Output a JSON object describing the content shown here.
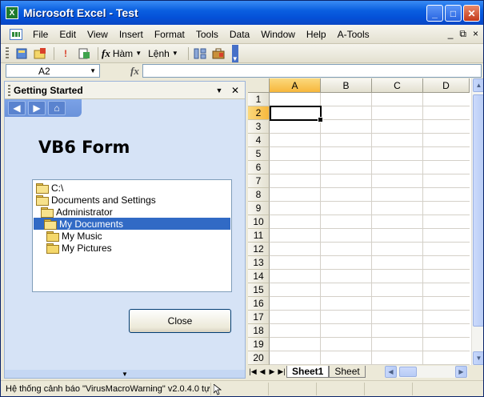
{
  "window": {
    "title": "Microsoft Excel - Test"
  },
  "menubar": {
    "items": [
      "File",
      "Edit",
      "View",
      "Insert",
      "Format",
      "Tools",
      "Data",
      "Window",
      "Help",
      "A-Tools"
    ],
    "right_controls": [
      "_",
      "⧉",
      "×"
    ]
  },
  "toolbar": {
    "ham_label": "Hàm",
    "lenh_label": "Lệnh"
  },
  "formulabar": {
    "namebox": "A2",
    "fx": "fx",
    "formula": ""
  },
  "taskpane": {
    "title": "Getting Started",
    "form_title": "VB6 Form",
    "tree": [
      {
        "label": "C:\\",
        "indent": 0,
        "open": true,
        "selected": false
      },
      {
        "label": "Documents and Settings",
        "indent": 0,
        "open": true,
        "selected": false
      },
      {
        "label": "Administrator",
        "indent": 1,
        "open": true,
        "selected": false
      },
      {
        "label": "My Documents",
        "indent": 1,
        "open": true,
        "selected": true
      },
      {
        "label": "My Music",
        "indent": 2,
        "open": false,
        "selected": false
      },
      {
        "label": "My Pictures",
        "indent": 2,
        "open": false,
        "selected": false
      }
    ],
    "close_label": "Close"
  },
  "grid": {
    "columns": [
      "A",
      "B",
      "C",
      "D"
    ],
    "rows": [
      "1",
      "2",
      "3",
      "4",
      "5",
      "6",
      "7",
      "8",
      "9",
      "10",
      "11",
      "12",
      "13",
      "14",
      "15",
      "16",
      "17",
      "18",
      "19",
      "20"
    ],
    "active_column": "A",
    "active_row": "2"
  },
  "sheets": {
    "tabs": [
      "Sheet1",
      "Sheet"
    ]
  },
  "statusbar": {
    "text": "Hệ thống cảnh báo \"VirusMacroWarning\" v2.0.4.0 tự"
  }
}
